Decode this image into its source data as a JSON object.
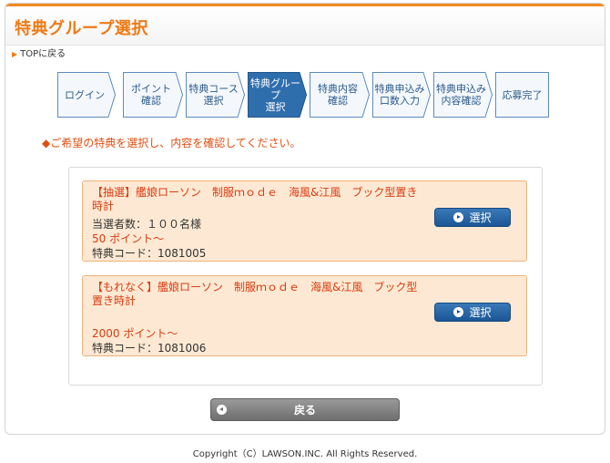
{
  "header": {
    "title": "特典グループ選択"
  },
  "nav": {
    "back_to_top": "TOPに戻る"
  },
  "steps": [
    {
      "label": "ログイン",
      "active": false
    },
    {
      "label": "ポイント\n確認",
      "active": false
    },
    {
      "label": "特典コース\n選択",
      "active": false
    },
    {
      "label": "特典グループ\n選択",
      "active": true
    },
    {
      "label": "特典内容\n確認",
      "active": false
    },
    {
      "label": "特典申込み\n口数入力",
      "active": false
    },
    {
      "label": "特典申込み\n内容確認",
      "active": false
    },
    {
      "label": "応募完了",
      "active": false
    }
  ],
  "instruction": "◆ご希望の特典を選択し、内容を確認してください。",
  "offers": [
    {
      "name": "【抽選】艦娘ローソン　制服ｍｏｄｅ　海風&江風　ブック型置き時計",
      "winners": "当選者数：１００名様",
      "points": "50 ポイント～",
      "code": "特典コード：1081005",
      "button": "選択"
    },
    {
      "name": "【もれなく】艦娘ローソン　制服ｍｏｄｅ　海風&江風　ブック型置き時計",
      "winners": "",
      "points": "2000 ポイント～",
      "code": "特典コード：1081006",
      "button": "選択"
    }
  ],
  "back_button": "戻る",
  "footer": "Copyright（C）LAWSON.INC. All Rights Reserved.",
  "colors": {
    "accent": "#ee7a14",
    "step_active": "#2f6ead",
    "offer_bg": "#fde9d3",
    "offer_text": "#d93a10"
  }
}
